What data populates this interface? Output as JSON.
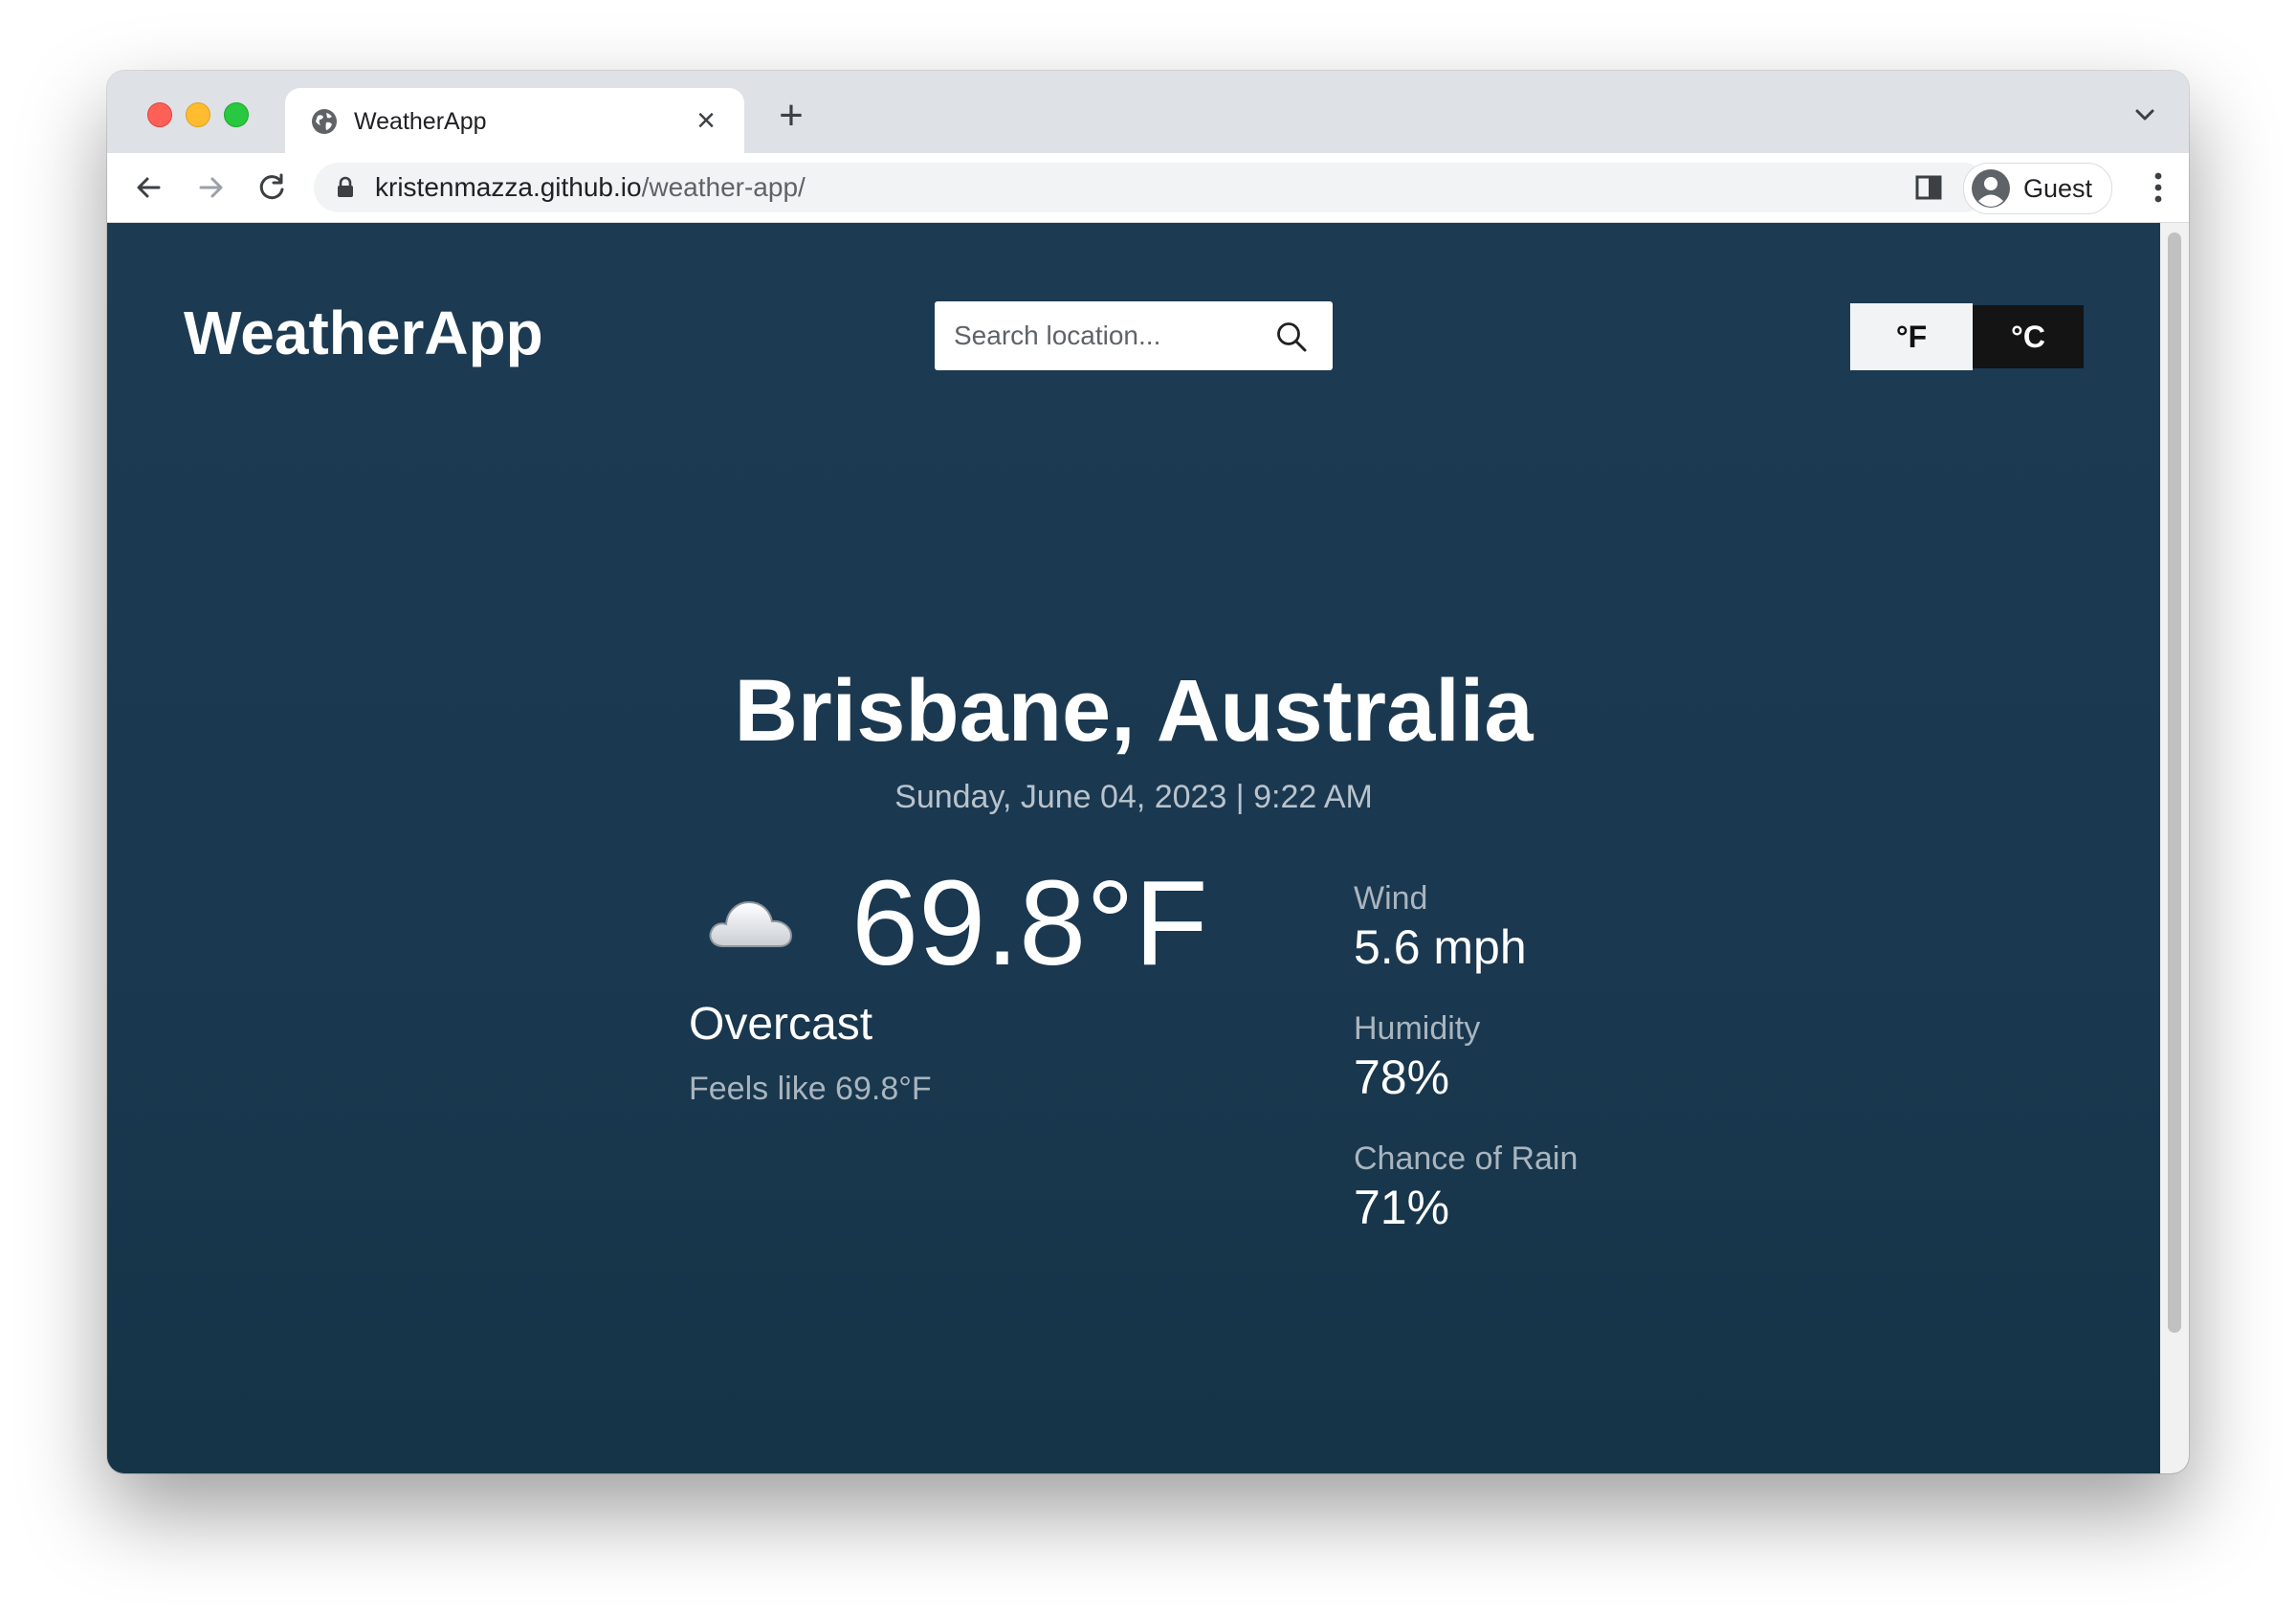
{
  "browser": {
    "tab_title": "WeatherApp",
    "new_tab": "+",
    "url_domain": "kristenmazza.github.io",
    "url_path": "/weather-app/",
    "profile_label": "Guest"
  },
  "app": {
    "logo": "WeatherApp",
    "search_placeholder": "Search location...",
    "units": {
      "fahrenheit": "°F",
      "celsius": "°C",
      "selected": "fahrenheit"
    }
  },
  "weather": {
    "location": "Brisbane, Australia",
    "datetime": "Sunday, June 04, 2023 | 9:22 AM",
    "icon": "cloud-icon",
    "temperature": "69.8°F",
    "condition": "Overcast",
    "feels_like": "Feels like 69.8°F",
    "stats": [
      {
        "label": "Wind",
        "value": "5.6 mph"
      },
      {
        "label": "Humidity",
        "value": "78%"
      },
      {
        "label": "Chance of Rain",
        "value": "71%"
      }
    ]
  },
  "colors": {
    "page_background": "#1c3b53",
    "toggle_active_bg": "#f1f3f4",
    "toggle_inactive_bg": "#141414"
  }
}
